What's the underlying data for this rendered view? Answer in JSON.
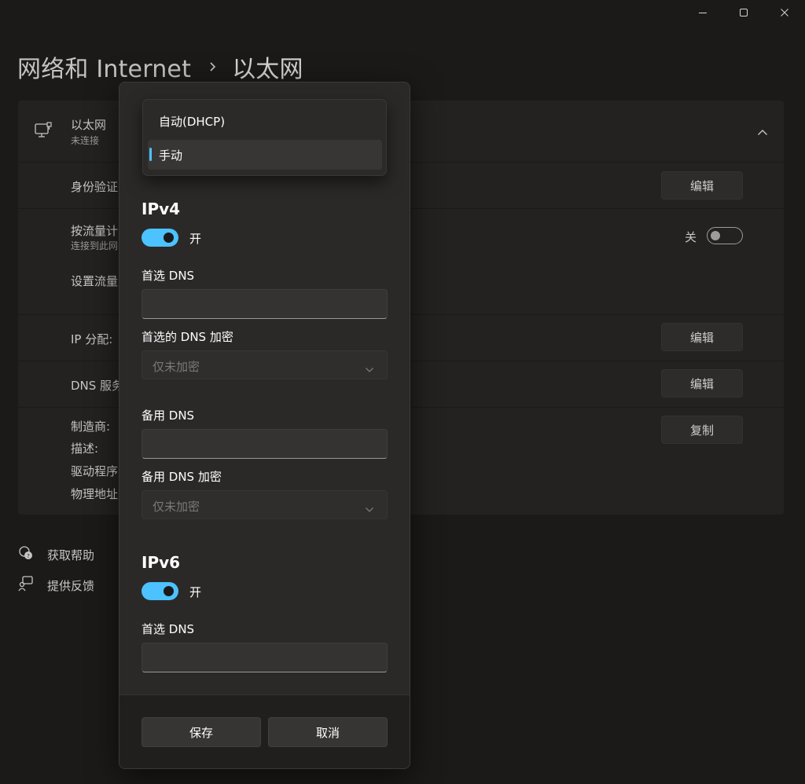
{
  "window": {
    "minimize_icon": "minimize-icon",
    "maximize_icon": "maximize-icon",
    "close_icon": "close-icon"
  },
  "breadcrumb": {
    "parent": "网络和 Internet",
    "current": "以太网"
  },
  "background": {
    "adapter_name": "以太网",
    "adapter_status": "未连接",
    "auth_label": "身份验证",
    "auth_button": "编辑",
    "metered_label": "按流量计",
    "metered_sub": "连接到此网",
    "metered_toggle_label": "关",
    "metered_on": false,
    "data_limit_label": "设置流量",
    "ip_label": "IP 分配:",
    "ip_button": "编辑",
    "dns_label": "DNS 服务",
    "dns_button": "编辑",
    "info_labels": [
      "制造商:",
      "描述:",
      "驱动程序",
      "物理地址"
    ],
    "copy_button": "复制"
  },
  "links": {
    "help": "获取帮助",
    "feedback": "提供反馈"
  },
  "dialog": {
    "ipv4": {
      "title": "IPv4",
      "toggle_label": "开",
      "enabled": true,
      "preferred_dns_label": "首选 DNS",
      "preferred_dns_value": "",
      "preferred_enc_label": "首选的 DNS 加密",
      "preferred_enc_value": "仅未加密",
      "alternate_dns_label": "备用 DNS",
      "alternate_dns_value": "",
      "alternate_enc_label": "备用 DNS 加密",
      "alternate_enc_value": "仅未加密"
    },
    "ipv6": {
      "title": "IPv6",
      "toggle_label": "开",
      "enabled": true,
      "preferred_dns_label": "首选 DNS",
      "preferred_dns_value": ""
    },
    "save_button": "保存",
    "cancel_button": "取消"
  },
  "dropdown": {
    "options": [
      "自动(DHCP)",
      "手动"
    ],
    "selected": "手动"
  },
  "colors": {
    "accent": "#4cc2ff",
    "background": "#1c1a19",
    "dialog": "#2b2928"
  }
}
